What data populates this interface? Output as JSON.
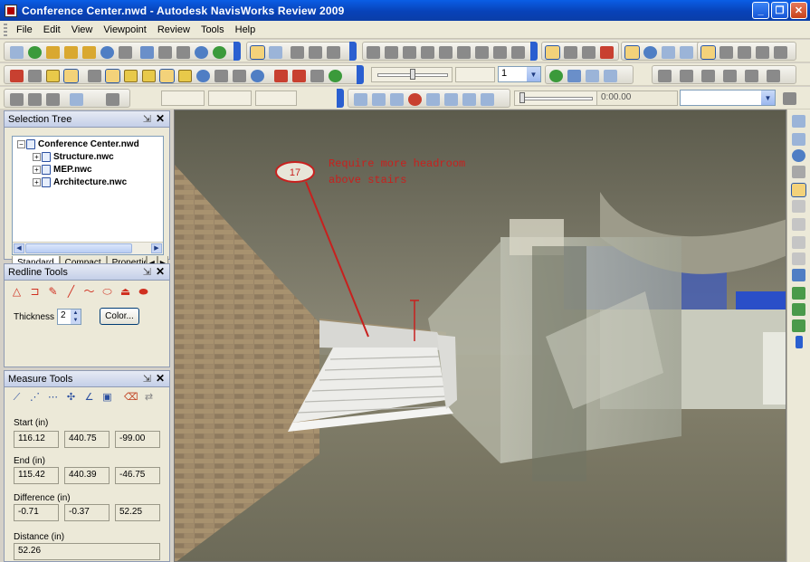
{
  "window": {
    "title": "Conference Center.nwd - Autodesk NavisWorks Review 2009"
  },
  "menu": [
    {
      "label": "File"
    },
    {
      "label": "Edit"
    },
    {
      "label": "View"
    },
    {
      "label": "Viewpoint"
    },
    {
      "label": "Review"
    },
    {
      "label": "Tools"
    },
    {
      "label": "Help"
    }
  ],
  "toolbar": {
    "combo_value": "1",
    "time_display": "0:00.00"
  },
  "selection_tree": {
    "title": "Selection Tree",
    "root": "Conference Center.nwd",
    "children": [
      "Structure.nwc",
      "MEP.nwc",
      "Architecture.nwc"
    ],
    "tabs": [
      "Standard",
      "Compact",
      "Properties"
    ]
  },
  "redline_tools": {
    "title": "Redline Tools",
    "thickness_label": "Thickness",
    "thickness_value": "2",
    "color_button": "Color..."
  },
  "measure_tools": {
    "title": "Measure Tools",
    "start_label": "Start (in)",
    "start": [
      "116.12",
      "440.75",
      "-99.00"
    ],
    "end_label": "End (in)",
    "end": [
      "115.42",
      "440.39",
      "-46.75"
    ],
    "difference_label": "Difference (in)",
    "difference": [
      "-0.71",
      "-0.37",
      "52.25"
    ],
    "distance_label": "Distance (in)",
    "distance": "52.26"
  },
  "viewport": {
    "tag_number": "17",
    "redline_note_line1": "Require more headroom",
    "redline_note_line2": "above stairs",
    "note_color": "#c8201e"
  },
  "colors": {
    "title_bar": "#0a4fd0",
    "panel_bg": "#ece9d8",
    "redline": "#c8201e"
  }
}
